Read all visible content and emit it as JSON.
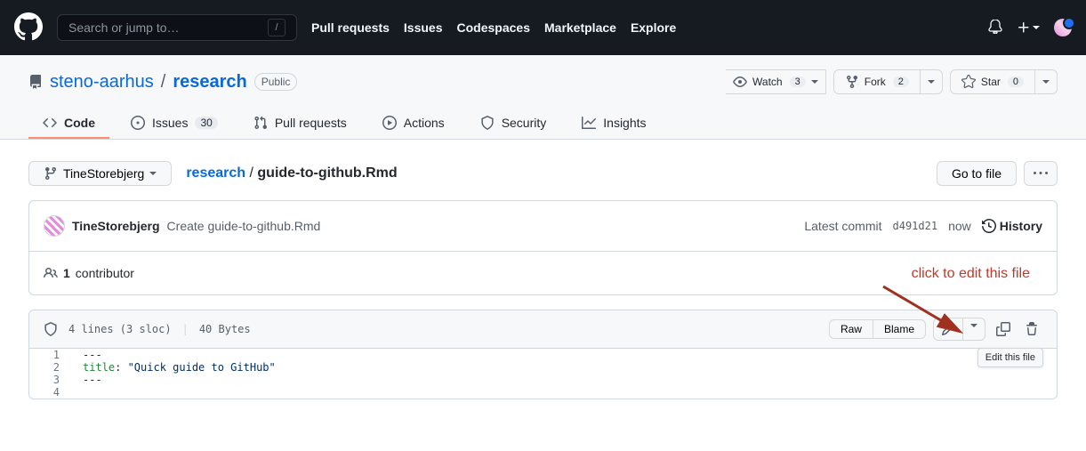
{
  "search": {
    "placeholder": "Search or jump to…",
    "slash": "/"
  },
  "nav": {
    "pulls": "Pull requests",
    "issues": "Issues",
    "codespaces": "Codespaces",
    "marketplace": "Marketplace",
    "explore": "Explore"
  },
  "repo": {
    "owner": "steno-aarhus",
    "name": "research",
    "visibility": "Public",
    "watch": {
      "label": "Watch",
      "count": "3"
    },
    "fork": {
      "label": "Fork",
      "count": "2"
    },
    "star": {
      "label": "Star",
      "count": "0"
    }
  },
  "tabs": {
    "code": "Code",
    "issues": "Issues",
    "issues_count": "30",
    "pulls": "Pull requests",
    "actions": "Actions",
    "security": "Security",
    "insights": "Insights"
  },
  "branch": "TineStorebjerg",
  "breadcrumb": {
    "root": "research",
    "sep": "/",
    "file": "guide-to-github.Rmd"
  },
  "go_to_file": "Go to file",
  "commit": {
    "author": "TineStorebjerg",
    "message": "Create guide-to-github.Rmd",
    "latest_label": "Latest commit",
    "sha": "d491d21",
    "time": "now",
    "history": "History"
  },
  "contributors": {
    "count": "1",
    "label": "contributor"
  },
  "file_meta": {
    "lines": "4 lines (3 sloc)",
    "size": "40 Bytes"
  },
  "file_actions": {
    "raw": "Raw",
    "blame": "Blame"
  },
  "code": {
    "l1": "---",
    "l2_key": "title",
    "l2_colon": ": ",
    "l2_val": "\"Quick guide to GitHub\"",
    "l3": "---"
  },
  "annotation": "click to edit this file",
  "tooltip": "Edit this file"
}
